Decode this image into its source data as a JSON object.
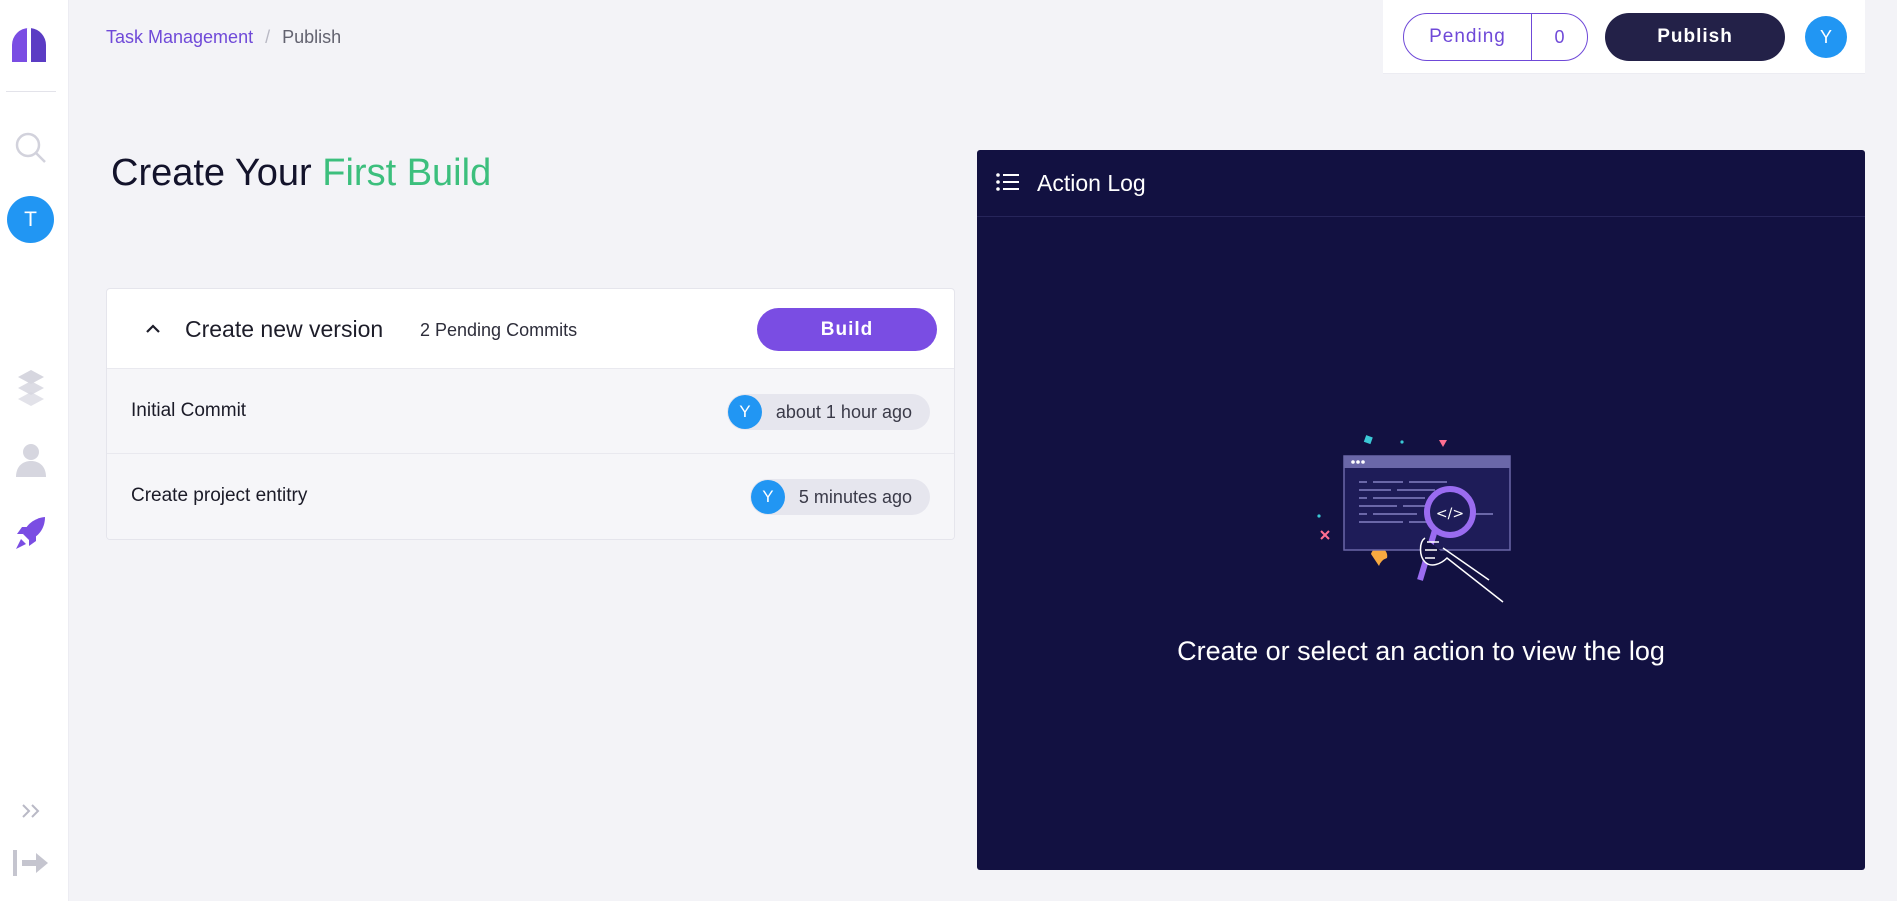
{
  "sidebar": {
    "avatar_initial": "T"
  },
  "breadcrumb": {
    "project": "Task Management",
    "separator": "/",
    "current": "Publish"
  },
  "topbar": {
    "pending_label": "Pending",
    "pending_count": "0",
    "publish_label": "Publish",
    "user_initial": "Y"
  },
  "page": {
    "title_prefix": "Create Your",
    "title_accent": "First Build"
  },
  "version_card": {
    "title": "Create new version",
    "pending_commits": "2 Pending Commits",
    "build_label": "Build",
    "commits": [
      {
        "title": "Initial Commit",
        "author_initial": "Y",
        "time": "about 1 hour ago"
      },
      {
        "title": "Create project entitry",
        "author_initial": "Y",
        "time": "5 minutes ago"
      }
    ]
  },
  "action_log": {
    "title": "Action Log",
    "empty_message": "Create or select an action to view the log"
  },
  "colors": {
    "accent_purple": "#7a4de3",
    "brand_dark": "#232148",
    "success_green": "#3cbf7d",
    "avatar_blue": "#2196f3",
    "log_background": "#121141"
  },
  "icons": [
    "logo-icon",
    "search-icon",
    "layers-icon",
    "user-icon",
    "rocket-icon",
    "expand-icon",
    "logout-icon",
    "chevron-up-icon",
    "list-icon"
  ]
}
